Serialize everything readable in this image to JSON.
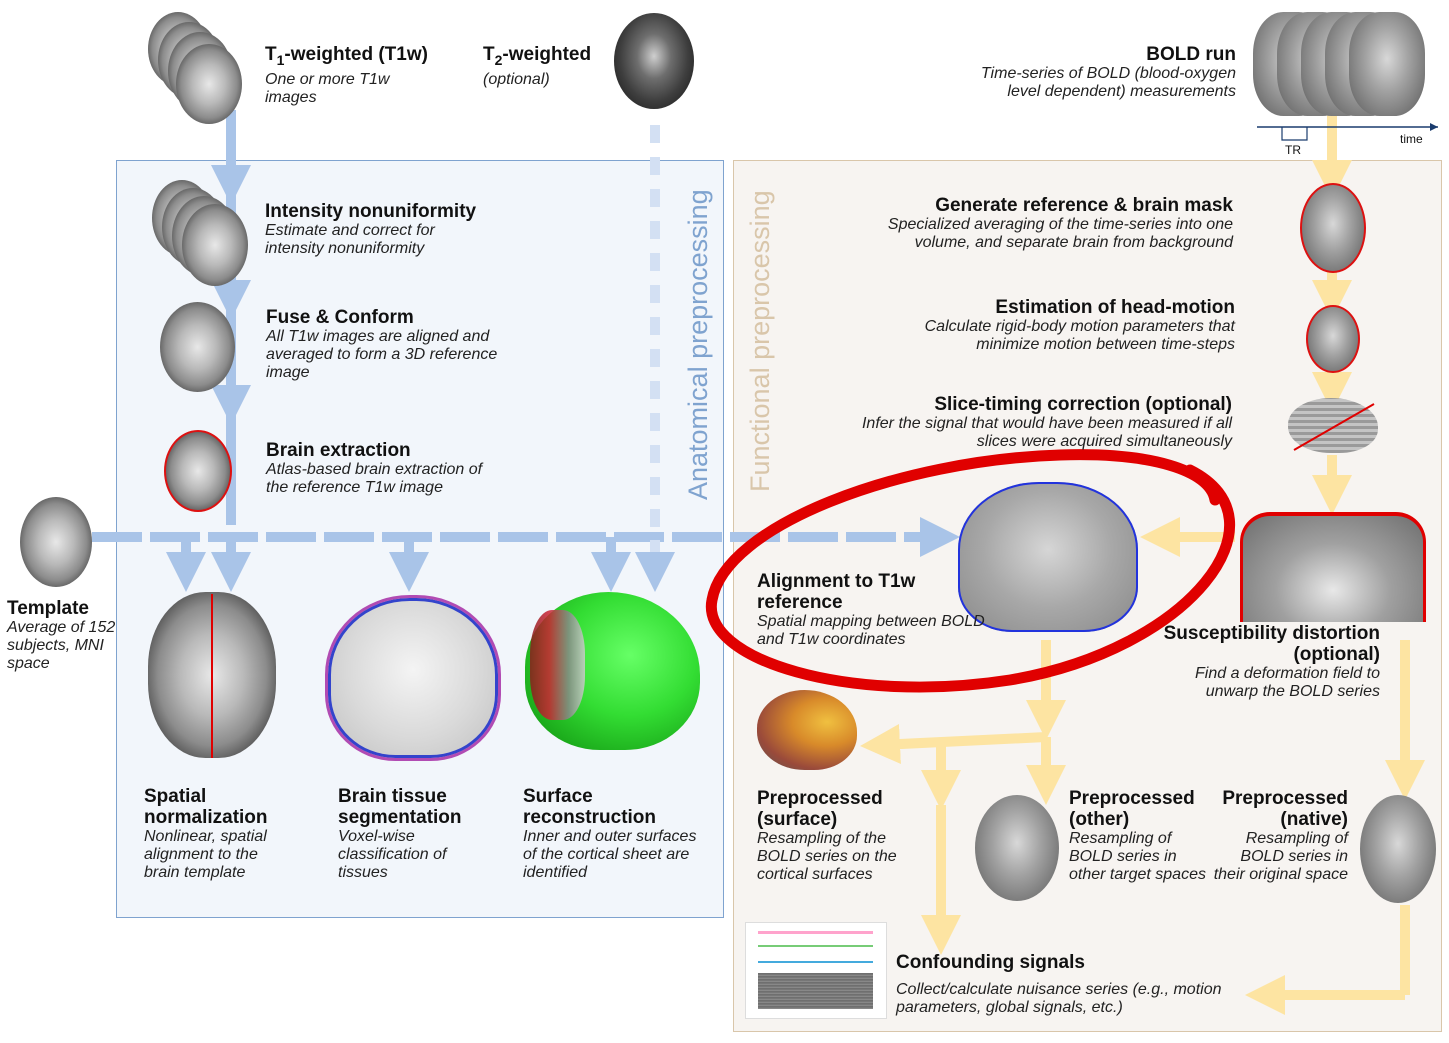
{
  "t1w": {
    "title_main": "T",
    "title_sub": "1",
    "title_rest": "-weighted (T1w)",
    "desc": "One or more T1w images"
  },
  "t2w": {
    "title_main": "T",
    "title_sub": "2",
    "title_rest": "-weighted",
    "desc": "(optional)"
  },
  "bold": {
    "title": "BOLD run",
    "desc": "Time-series of BOLD (blood-oxygen level dependent) measurements",
    "tr": "TR",
    "time": "time"
  },
  "panels": {
    "anatomical": "Anatomical preprocessing",
    "functional": "Functional preprocessing"
  },
  "anatomical_steps": [
    {
      "title": "Intensity nonuniformity",
      "desc": "Estimate and correct for intensity nonuniformity"
    },
    {
      "title": "Fuse & Conform",
      "desc": "All T1w images are aligned and averaged to form a 3D reference image"
    },
    {
      "title": "Brain extraction",
      "desc": "Atlas-based brain extraction of the reference T1w image"
    }
  ],
  "template": {
    "title": "Template",
    "desc": "Average of 152 subjects, MNI space"
  },
  "bottom_anat": [
    {
      "title": "Spatial normalization",
      "desc": "Nonlinear, spatial alignment to the brain template"
    },
    {
      "title": "Brain tissue segmentation",
      "desc": "Voxel-wise classification of tissues"
    },
    {
      "title": "Surface reconstruction",
      "desc": "Inner and outer surfaces of the cortical sheet are identified"
    }
  ],
  "functional_steps": [
    {
      "title": "Generate reference & brain mask",
      "desc": "Specialized averaging of the time-series into one volume, and separate brain from background"
    },
    {
      "title": "Estimation of head-motion",
      "desc": "Calculate rigid-body motion parameters that minimize motion between time-steps"
    },
    {
      "title": "Slice-timing correction (optional)",
      "desc": "Infer the signal that would have been measured if all slices were acquired simultaneously"
    }
  ],
  "alignment": {
    "title": "Alignment to T1w reference",
    "desc": "Spatial mapping between BOLD and T1w coordinates"
  },
  "susceptibility": {
    "title": "Susceptibility distortion (optional)",
    "desc": "Find a deformation field to unwarp the BOLD series"
  },
  "outputs": [
    {
      "title": "Preprocessed (surface)",
      "desc": "Resampling of the BOLD series on the cortical surfaces"
    },
    {
      "title": "Preprocessed (other)",
      "desc": "Resampling of BOLD series in other target spaces"
    },
    {
      "title": "Preprocessed (native)",
      "desc": "Resampling of BOLD series in their original space"
    }
  ],
  "confounds": {
    "title": "Confounding signals",
    "desc": "Collect/calculate nuisance series (e.g., motion parameters, global signals, etc.)"
  },
  "colors": {
    "anat_arrow": "#a9c4e8",
    "func_arrow": "#fde4a2",
    "highlight": "#e00000",
    "anat_text": "#7fa3cf",
    "func_text": "#d9c6aa"
  }
}
